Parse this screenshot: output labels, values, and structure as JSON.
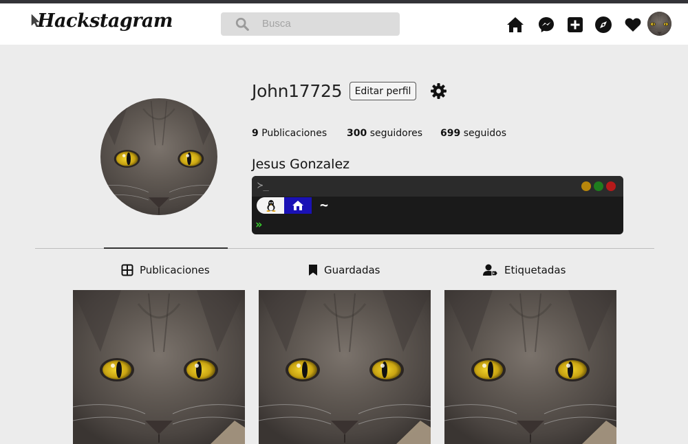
{
  "app": {
    "logo": "Hackstagram"
  },
  "search": {
    "placeholder": "Busca"
  },
  "nav": {
    "icons": [
      "home-icon",
      "messenger-icon",
      "add-post-icon",
      "explore-icon",
      "heart-icon"
    ]
  },
  "profile": {
    "username": "John17725",
    "edit_label": "Editar perfil",
    "stats": {
      "posts_count": "9",
      "posts_label": "Publicaciones",
      "followers_count": "300",
      "followers_label": "seguidores",
      "following_count": "699",
      "following_label": "seguidos"
    },
    "full_name": "Jesus Gonzalez"
  },
  "terminal": {
    "prompt_icon": "≻_",
    "path": "~",
    "chevrons": "»"
  },
  "tabs": [
    {
      "label": "Publicaciones",
      "icon": "grid-icon",
      "active": true
    },
    {
      "label": "Guardadas",
      "icon": "bookmark-icon",
      "active": false
    },
    {
      "label": "Etiquetadas",
      "icon": "user-tag-icon",
      "active": false
    }
  ],
  "colors": {
    "terminal_dot_yellow": "#b8860b",
    "terminal_dot_green": "#1e7d1e",
    "terminal_dot_red": "#b51a1a",
    "home_segment": "#1a11b5",
    "prompt_green": "#3ad32e"
  }
}
